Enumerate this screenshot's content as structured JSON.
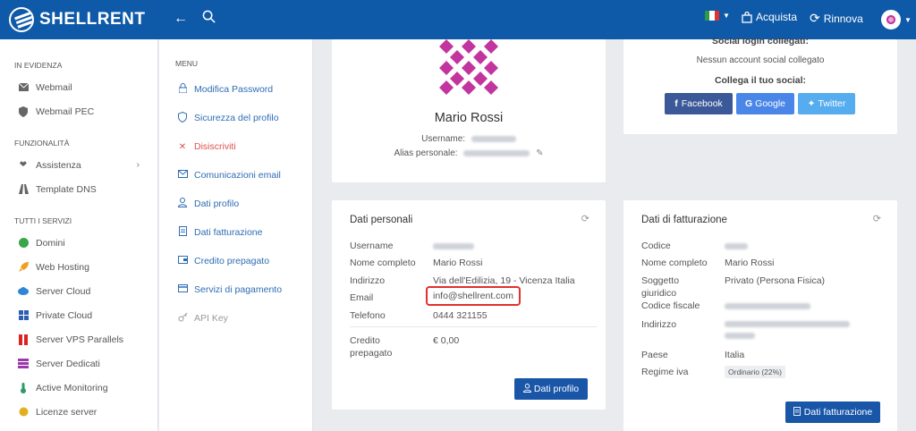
{
  "topbar": {
    "brand": "SHELLRENT",
    "acquista_label": "Acquista",
    "rinnova_label": "Rinnova"
  },
  "sidebar": {
    "sections": [
      {
        "title": "IN EVIDENZA",
        "items": [
          {
            "label": "Webmail",
            "icon": "mail-icon"
          },
          {
            "label": "Webmail PEC",
            "icon": "shield-icon"
          }
        ]
      },
      {
        "title": "FUNZIONALITÀ",
        "items": [
          {
            "label": "Assistenza",
            "icon": "heart-icon"
          },
          {
            "label": "Template DNS",
            "icon": "road-icon"
          }
        ]
      },
      {
        "title": "TUTTI I SERVIZI",
        "items": [
          {
            "label": "Domini",
            "icon": "globe-icon"
          },
          {
            "label": "Web Hosting",
            "icon": "rocket-icon"
          },
          {
            "label": "Server Cloud",
            "icon": "cloud-icon"
          },
          {
            "label": "Private Cloud",
            "icon": "grid-icon"
          },
          {
            "label": "Server VPS Parallels",
            "icon": "parallels-icon"
          },
          {
            "label": "Server Dedicati",
            "icon": "server-icon"
          },
          {
            "label": "Active Monitoring",
            "icon": "thermometer-icon"
          },
          {
            "label": "Licenze server",
            "icon": "license-icon"
          }
        ]
      }
    ]
  },
  "menu": {
    "title": "MENU",
    "items": [
      {
        "label": "Modifica Password",
        "icon": "lock-icon"
      },
      {
        "label": "Sicurezza del profilo",
        "icon": "shield-icon"
      },
      {
        "label": "Disiscriviti",
        "icon": "close-icon"
      },
      {
        "label": "Comunicazioni email",
        "icon": "envelope-icon"
      },
      {
        "label": "Dati profilo",
        "icon": "user-icon"
      },
      {
        "label": "Dati fatturazione",
        "icon": "invoice-icon"
      },
      {
        "label": "Credito prepagato",
        "icon": "wallet-icon"
      },
      {
        "label": "Servizi di pagamento",
        "icon": "card-icon"
      },
      {
        "label": "API Key",
        "icon": "key-icon"
      }
    ]
  },
  "profile": {
    "name": "Mario Rossi",
    "username_label": "Username:",
    "alias_label": "Alias personale:"
  },
  "social": {
    "linked_title": "Social login collegati:",
    "none_text": "Nessun account social collegato",
    "connect_title": "Collega il tuo social:",
    "facebook": "Facebook",
    "google": "Google",
    "twitter": "Twitter"
  },
  "personal": {
    "title": "Dati personali",
    "username_label": "Username",
    "fullname_label": "Nome completo",
    "fullname_value": "Mario Rossi",
    "address_label": "Indirizzo",
    "address_value": "Via dell'Edilizia, 19 - Vicenza Italia",
    "email_label": "Email",
    "email_value": "info@shellrent.com",
    "phone_label": "Telefono",
    "phone_value": "0444 321155",
    "credit_label": "Credito prepagato",
    "credit_value": "€ 0,00",
    "button": "Dati profilo"
  },
  "billing": {
    "title": "Dati di fatturazione",
    "code_label": "Codice",
    "fullname_label": "Nome completo",
    "fullname_value": "Mario Rossi",
    "subject_label": "Soggetto giuridico",
    "subject_value": "Privato (Persona Fisica)",
    "tax_label": "Codice fiscale",
    "address_label": "Indirizzo",
    "country_label": "Paese",
    "country_value": "Italia",
    "vat_label": "Regime iva",
    "vat_value": "Ordinario (22%)",
    "button": "Dati fatturazione"
  },
  "colors": {
    "brand": "#0f5aa8",
    "link": "#2e6db4",
    "danger": "#d9534f",
    "highlight": "#e03030"
  }
}
